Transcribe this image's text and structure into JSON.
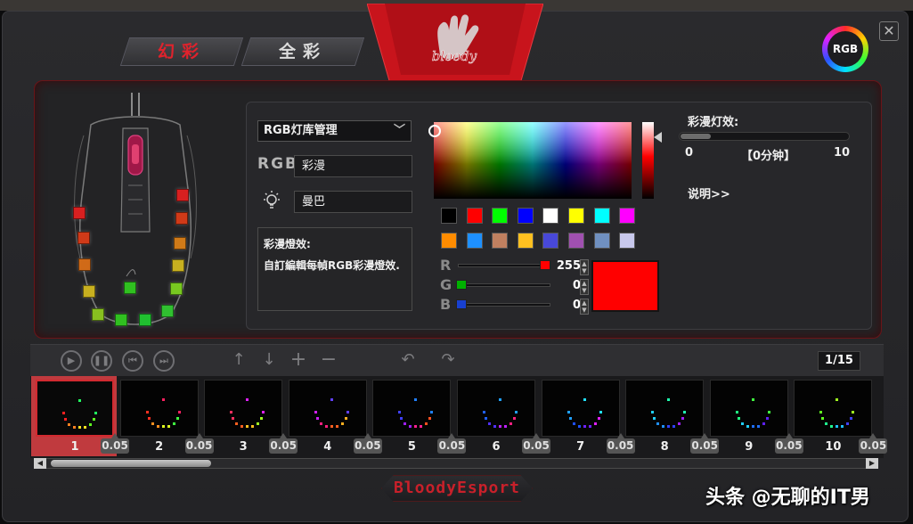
{
  "tabs": [
    "幻彩",
    "全彩"
  ],
  "logo": {
    "text": "bloody"
  },
  "rgb_button": "RGB",
  "close": "✕",
  "settings": {
    "library_select": "RGB灯库管理",
    "rgb_label": "RGB",
    "effect_name": "彩漫",
    "light_name": "曼巴",
    "description_title": "彩漫燈效:",
    "description_body": "自訂編輯每幀RGB彩漫燈效."
  },
  "swatches": [
    "#000000",
    "#ff0000",
    "#00ff00",
    "#0000ff",
    "#ffffff",
    "#ffff00",
    "#00ffff",
    "#ff00ff",
    "#ff8c00",
    "#1e90ff",
    "#c08060",
    "#ffc020",
    "#4848d8",
    "#a050b0",
    "#7090c0",
    "#c8c8ec"
  ],
  "channels": [
    {
      "label": "R",
      "value": "255",
      "color": "#ff0000",
      "fraction": 1.0
    },
    {
      "label": "G",
      "value": "0",
      "color": "#00b000",
      "fraction": 0.0
    },
    {
      "label": "B",
      "value": "0",
      "color": "#1840d0",
      "fraction": 0.0
    }
  ],
  "preview_color": "#ff0000",
  "speed": {
    "label": "彩漫灯效:",
    "min": "0",
    "max": "10",
    "unit": "【0分钟】",
    "fraction": 0.18
  },
  "info_link": "说明>>",
  "toolbar_icons": [
    "play-icon",
    "pause-icon",
    "skip-back-icon",
    "skip-forward-icon",
    "arrow-up-icon",
    "arrow-down-icon",
    "plus-icon",
    "minus-icon",
    "undo-icon",
    "redo-icon"
  ],
  "page_indicator": "1/15",
  "frames": [
    {
      "num": "1",
      "dur": "0.05"
    },
    {
      "num": "2",
      "dur": "0.05"
    },
    {
      "num": "3",
      "dur": "0.05"
    },
    {
      "num": "4",
      "dur": "0.05"
    },
    {
      "num": "5",
      "dur": "0.05"
    },
    {
      "num": "6",
      "dur": "0.05"
    },
    {
      "num": "7",
      "dur": "0.05"
    },
    {
      "num": "8",
      "dur": "0.05"
    },
    {
      "num": "9",
      "dur": "0.05"
    },
    {
      "num": "10",
      "dur": "0.05"
    }
  ],
  "mouse_leds": [
    "#d82020",
    "#d03a18",
    "#d06a18",
    "#c8b020",
    "#88c020",
    "#30c020",
    "#20c030",
    "#30c030",
    "#78c820",
    "#c8b020",
    "#d07a18",
    "#d03a18",
    "#d82020"
  ],
  "brand": "BloodyEsport",
  "watermark": "头条 @无聊的IT男"
}
